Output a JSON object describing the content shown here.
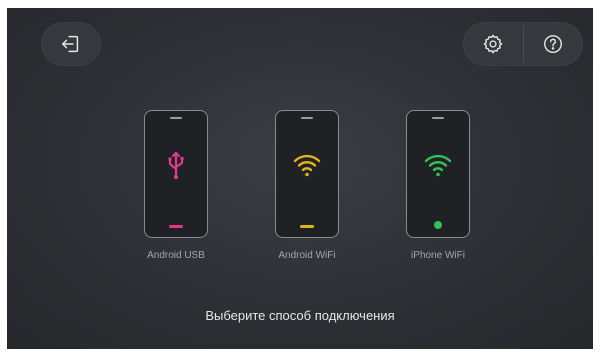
{
  "toolbar": {
    "exit_icon": "exit-icon",
    "settings_icon": "gear-icon",
    "help_icon": "help-icon"
  },
  "devices": [
    {
      "label": "Android USB",
      "icon": "usb-icon",
      "accent": "#e03a8f"
    },
    {
      "label": "Android WiFi",
      "icon": "wifi-icon",
      "accent": "#e0b21c"
    },
    {
      "label": "iPhone WiFi",
      "icon": "wifi-icon",
      "accent": "#35c25a"
    }
  ],
  "prompt": "Выберите способ подключения",
  "colors": {
    "background": "#2e3035",
    "button": "#35383d",
    "text": "#e6e6e6"
  }
}
